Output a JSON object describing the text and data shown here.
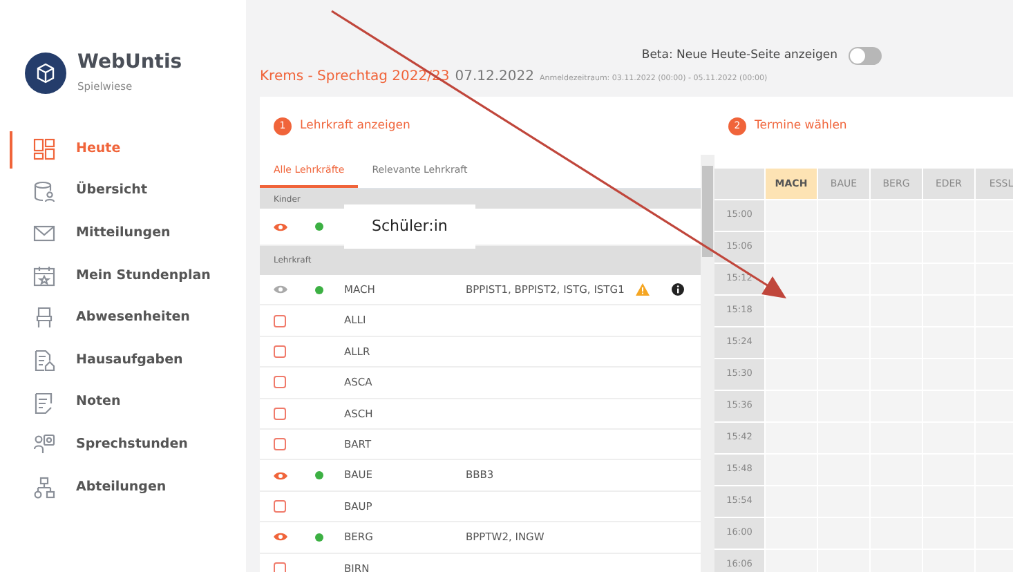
{
  "sidebar": {
    "app_name": "WebUntis",
    "subtitle": "Spielwiese",
    "items": [
      {
        "label": "Heute",
        "selected": true
      },
      {
        "label": "Übersicht",
        "selected": false
      },
      {
        "label": "Mitteilungen",
        "selected": false
      },
      {
        "label": "Mein Stundenplan",
        "selected": false
      },
      {
        "label": "Abwesenheiten",
        "selected": false
      },
      {
        "label": "Hausaufgaben",
        "selected": false
      },
      {
        "label": "Noten",
        "selected": false
      },
      {
        "label": "Sprechstunden",
        "selected": false
      },
      {
        "label": "Abteilungen",
        "selected": false
      }
    ]
  },
  "header": {
    "title": "Krems - Sprechtag 2022/23",
    "date": "07.12.2022",
    "period": "Anmeldezeitraum: 03.11.2022 (00:00) - 05.11.2022 (00:00)",
    "beta_label": "Beta: Neue Heute-Seite anzeigen",
    "beta_on": false
  },
  "step1": {
    "number": "1",
    "title": "Lehrkraft anzeigen",
    "tabs": [
      {
        "label": "Alle Lehrkräfte",
        "selected": true
      },
      {
        "label": "Relevante Lehrkraft",
        "selected": false
      }
    ],
    "sections": [
      {
        "title": "Kinder",
        "kind": "children",
        "rows": [
          {
            "kind": "eye",
            "active": true,
            "online": true,
            "name": "Schüler:in",
            "subjects": "",
            "warning": false,
            "info": false
          }
        ]
      },
      {
        "title": "Lehrkraft",
        "kind": "teachers",
        "rows": [
          {
            "kind": "eye",
            "active": false,
            "online": true,
            "name": "MACH",
            "subjects": "BPPIST1, BPPIST2, ISTG, ISTG1",
            "warning": true,
            "info": true
          },
          {
            "kind": "checkbox",
            "checked": false,
            "online": false,
            "name": "ALLI",
            "subjects": "",
            "warning": false,
            "info": false
          },
          {
            "kind": "checkbox",
            "checked": false,
            "online": false,
            "name": "ALLR",
            "subjects": "",
            "warning": false,
            "info": false
          },
          {
            "kind": "checkbox",
            "checked": false,
            "online": false,
            "name": "ASCA",
            "subjects": "",
            "warning": false,
            "info": false
          },
          {
            "kind": "checkbox",
            "checked": false,
            "online": false,
            "name": "ASCH",
            "subjects": "",
            "warning": false,
            "info": false
          },
          {
            "kind": "checkbox",
            "checked": false,
            "online": false,
            "name": "BART",
            "subjects": "",
            "warning": false,
            "info": false
          },
          {
            "kind": "eye",
            "active": true,
            "online": true,
            "name": "BAUE",
            "subjects": "BBB3",
            "warning": false,
            "info": false
          },
          {
            "kind": "checkbox",
            "checked": false,
            "online": false,
            "name": "BAUP",
            "subjects": "",
            "warning": false,
            "info": false
          },
          {
            "kind": "eye",
            "active": true,
            "online": true,
            "name": "BERG",
            "subjects": "BPPTW2, INGW",
            "warning": false,
            "info": false
          },
          {
            "kind": "checkbox",
            "checked": false,
            "online": false,
            "name": "BIRN",
            "subjects": "",
            "warning": false,
            "info": false
          }
        ]
      }
    ]
  },
  "step2": {
    "number": "2",
    "title": "Termine wählen",
    "columns": [
      {
        "label": "MACH",
        "selected": true
      },
      {
        "label": "BAUE",
        "selected": false
      },
      {
        "label": "BERG",
        "selected": false
      },
      {
        "label": "EDER",
        "selected": false
      },
      {
        "label": "ESSL",
        "selected": false
      }
    ],
    "times": [
      "15:00",
      "15:06",
      "15:12",
      "15:18",
      "15:24",
      "15:30",
      "15:36",
      "15:42",
      "15:48",
      "15:54",
      "16:00",
      "16:06"
    ]
  }
}
